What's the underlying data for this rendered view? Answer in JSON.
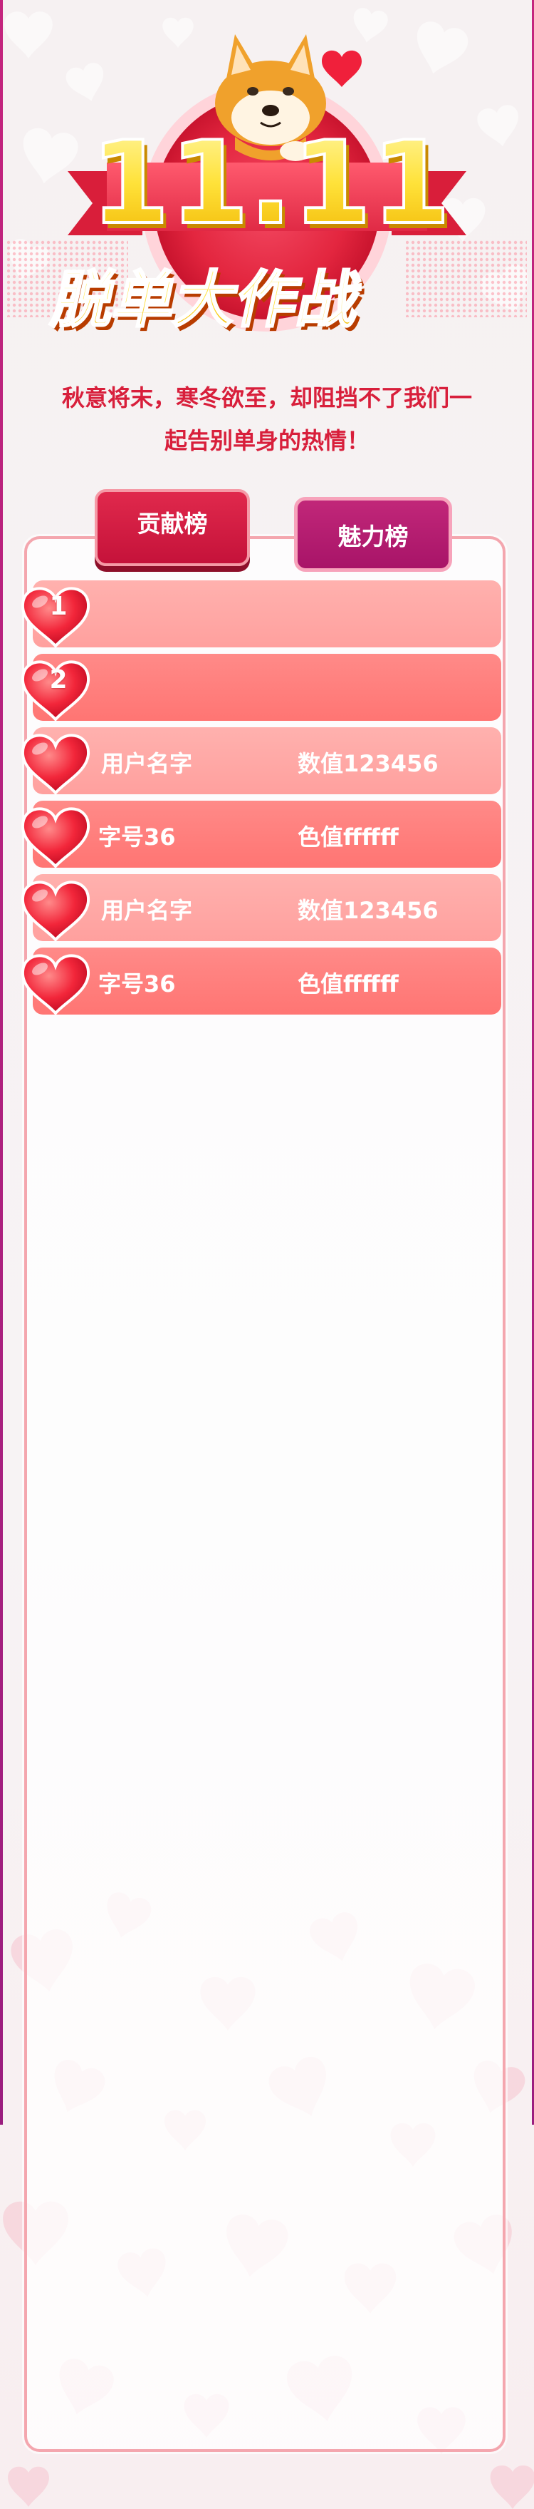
{
  "banner": {
    "title_number": "11.11",
    "title_text": "脱单大作战"
  },
  "slogan": {
    "line1": "秋意将末，寒冬欲至，却阻挡不了我们一",
    "line2": "起告别单身的热情！"
  },
  "tabs": {
    "contribution": "贡献榜",
    "charm": "魅力榜"
  },
  "ranking": [
    {
      "rank": "1",
      "name": "",
      "value": ""
    },
    {
      "rank": "2",
      "name": "",
      "value": ""
    },
    {
      "rank": "",
      "name": "用户名字",
      "value": "数值123456"
    },
    {
      "rank": "",
      "name": "字号36",
      "value": "色值ffffff"
    },
    {
      "rank": "",
      "name": "用户名字",
      "value": "数值123456"
    },
    {
      "rank": "",
      "name": "字号36",
      "value": "色值ffffff"
    }
  ],
  "colors": {
    "slogan": "#d81f3b",
    "tab_active": "#c5123a",
    "tab_inactive": "#a81468",
    "row_light": "#ffa09e",
    "row_dark": "#ff7573",
    "panel_border": "#f4a6ae"
  },
  "icons": {
    "mascot": "shiba-dog-icon",
    "rank_marker": "heart-icon"
  }
}
